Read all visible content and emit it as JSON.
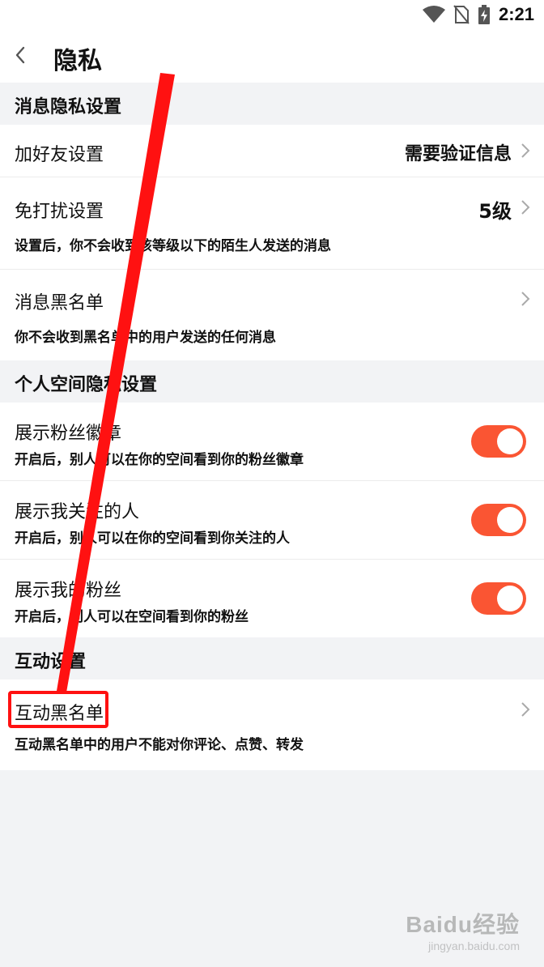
{
  "status_bar": {
    "time": "2:21"
  },
  "header": {
    "title": "隐私"
  },
  "sections": {
    "message": {
      "title": "消息隐私设置"
    },
    "space": {
      "title": "个人空间隐私设置"
    },
    "interaction": {
      "title": "互动设置"
    }
  },
  "rows": {
    "add_friend": {
      "label": "加好友设置",
      "value": "需要验证信息"
    },
    "dnd": {
      "label": "免打扰设置",
      "value": "5级",
      "desc": "设置后，你不会收到该等级以下的陌生人发送的消息"
    },
    "msg_blacklist": {
      "label": "消息黑名单",
      "desc": "你不会收到黑名单中的用户发送的任何消息"
    },
    "show_badge": {
      "label": "展示粉丝徽章",
      "desc": "开启后，别人可以在你的空间看到你的粉丝徽章",
      "enabled": true
    },
    "show_following": {
      "label": "展示我关注的人",
      "desc": "开启后，别人可以在你的空间看到你关注的人",
      "enabled": true
    },
    "show_fans": {
      "label": "展示我的粉丝",
      "desc": "开启后，别人可以在空间看到你的粉丝",
      "enabled": true
    },
    "interact_blacklist": {
      "label": "互动黑名单",
      "desc": "互动黑名单中的用户不能对你评论、点赞、转发"
    }
  },
  "watermark": {
    "main": "Baidu经验",
    "sub": "jingyan.baidu.com"
  },
  "colors": {
    "toggle_on": "#fa5533",
    "annotation": "#ff1111",
    "background": "#f2f3f5"
  },
  "icons": [
    "wifi-icon",
    "no-sim-icon",
    "battery-icon",
    "back-chevron-icon",
    "chevron-right-icon"
  ]
}
